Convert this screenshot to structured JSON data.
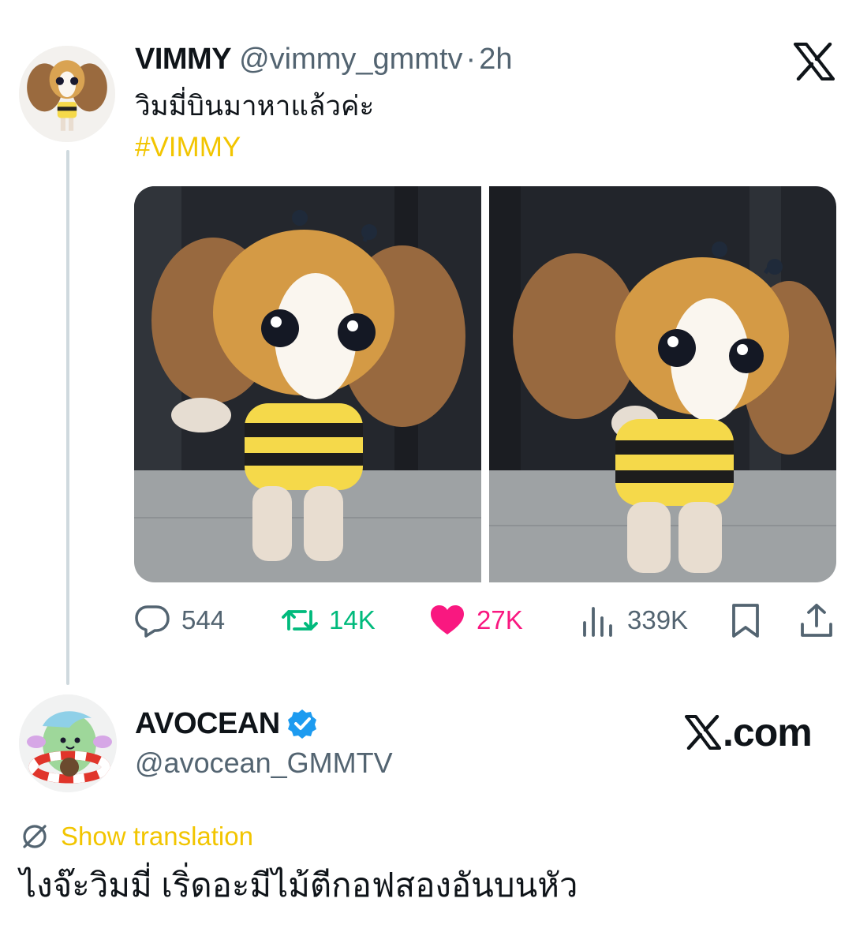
{
  "tweet": {
    "author_name": "VIMMY",
    "author_handle": "@vimmy_gmmtv",
    "separator": "·",
    "time": "2h",
    "text": "วิมมี่บินมาหาแล้วค่ะ",
    "hashtag": "#VIMMY",
    "stats": {
      "replies": "544",
      "reposts": "14K",
      "likes": "27K",
      "views": "339K"
    }
  },
  "reply": {
    "author_name": "AVOCEAN",
    "author_handle": "@avocean_GMMTV",
    "site_label": ".com",
    "show_translation": "Show translation",
    "text": "ไงจ๊ะวิมมี่ เริ่ดอะมีไม้ตีกอฟสองอันบนหัว"
  },
  "colors": {
    "accent_yellow": "#f2c500",
    "repost_green": "#00ba7c",
    "like_pink": "#f91880",
    "verified_blue": "#1d9bf0",
    "muted": "#536471"
  },
  "icons": [
    "x-logo-icon",
    "reply-icon",
    "repost-icon",
    "heart-icon",
    "views-icon",
    "bookmark-icon",
    "share-icon",
    "verified-badge-icon",
    "translate-icon"
  ]
}
